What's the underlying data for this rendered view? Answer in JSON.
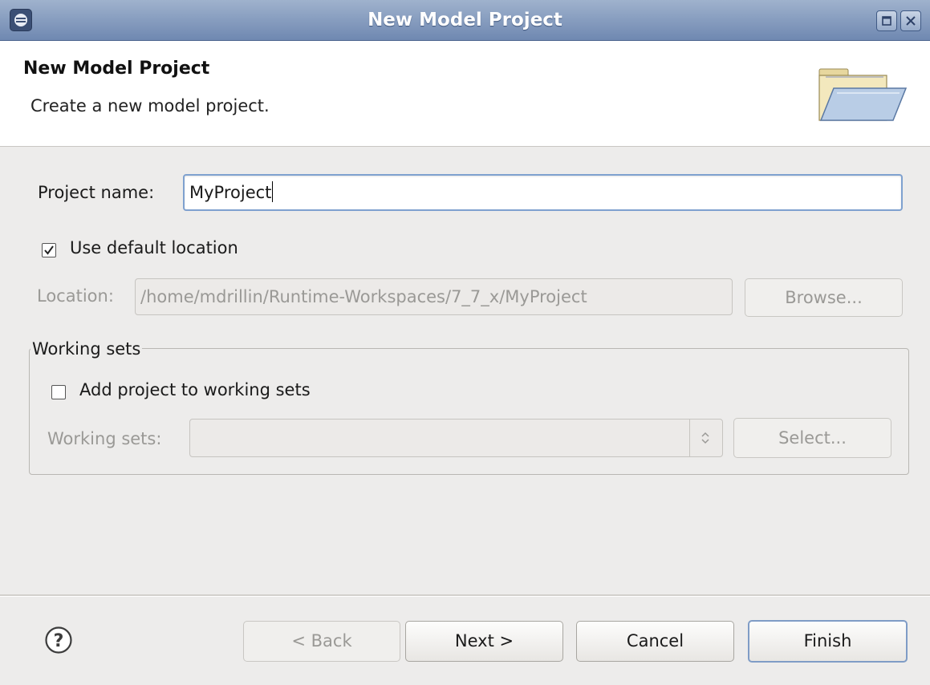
{
  "window": {
    "title": "New Model Project"
  },
  "banner": {
    "title": "New Model Project",
    "description": "Create a new model project.",
    "icon": "folder-open-icon"
  },
  "form": {
    "project_name_label": "Project name:",
    "project_name_value": "MyProject",
    "use_default_location_label": "Use default location",
    "use_default_location_checked": true,
    "location_label": "Location:",
    "location_value": "/home/mdrillin/Runtime-Workspaces/7_7_x/MyProject",
    "browse_label": "Browse...",
    "working_sets_group_label": "Working sets",
    "add_to_working_sets_label": "Add project to working sets",
    "add_to_working_sets_checked": false,
    "working_sets_label": "Working sets:",
    "working_sets_value": "",
    "select_label": "Select..."
  },
  "footer": {
    "back_label": "< Back",
    "next_label": "Next >",
    "cancel_label": "Cancel",
    "finish_label": "Finish",
    "help_icon": "help-icon"
  },
  "colors": {
    "titlebar": "#7f96bd",
    "dialog_bg": "#edeceb",
    "focus_border": "#7fa1cf",
    "disabled_text": "#9a9996"
  }
}
